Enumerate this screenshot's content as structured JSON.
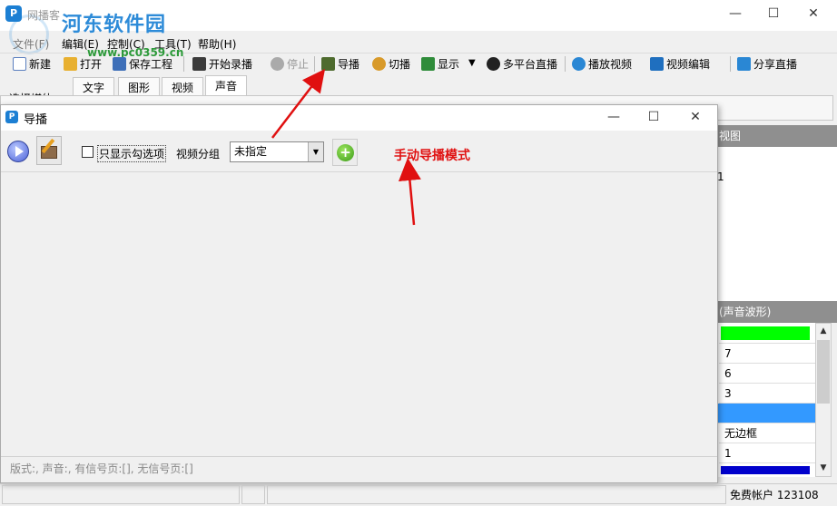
{
  "window": {
    "title": "网播客",
    "minimize_glyph": "—",
    "maximize_glyph": "☐",
    "close_glyph": "✕"
  },
  "watermark": {
    "title": "河东软件园",
    "url": "www.pc0359.cn"
  },
  "menu": {
    "file": "文件(F)",
    "edit": "编辑(E)",
    "control": "控制(C)",
    "tools": "工具(T)",
    "help": "帮助(H)"
  },
  "toolbar": {
    "new": "新建",
    "open": "打开",
    "save_project": "保存工程",
    "start_record": "开始录播",
    "stop": "停止",
    "director": "导播",
    "switch": "切播",
    "display": "显示",
    "multi_platform": "多平台直播",
    "play_video": "播放视频",
    "video_edit": "视频编辑",
    "share_live": "分享直播",
    "dropdown_glyph": "▼"
  },
  "media": {
    "select_label": "选择媒体-->",
    "tabs": [
      "文字",
      "图形",
      "视频",
      "声音"
    ]
  },
  "right_pane": {
    "header": "视图",
    "number": "1",
    "props_header": "(声音波形)",
    "props_rows": [
      "7",
      "6",
      "3",
      "",
      "无边框",
      "1"
    ],
    "swatch_green": "#00ff00",
    "swatch_blue": "#0000cc",
    "row_selected": "#3399ff",
    "up_glyph": "▲",
    "down_glyph": "▼"
  },
  "dialog": {
    "title": "导播",
    "only_checked_label": "只显示勾选项",
    "video_group_label": "视频分组",
    "video_group_value": "未指定",
    "select_arrow": "▼",
    "add_glyph": "+",
    "status": "版式:, 声音:, 有信号页:[], 无信号页:[]"
  },
  "annotation": {
    "text": "手动导播模式",
    "color": "#e01010"
  },
  "statusbar": {
    "account": "免费帐户 123108"
  }
}
